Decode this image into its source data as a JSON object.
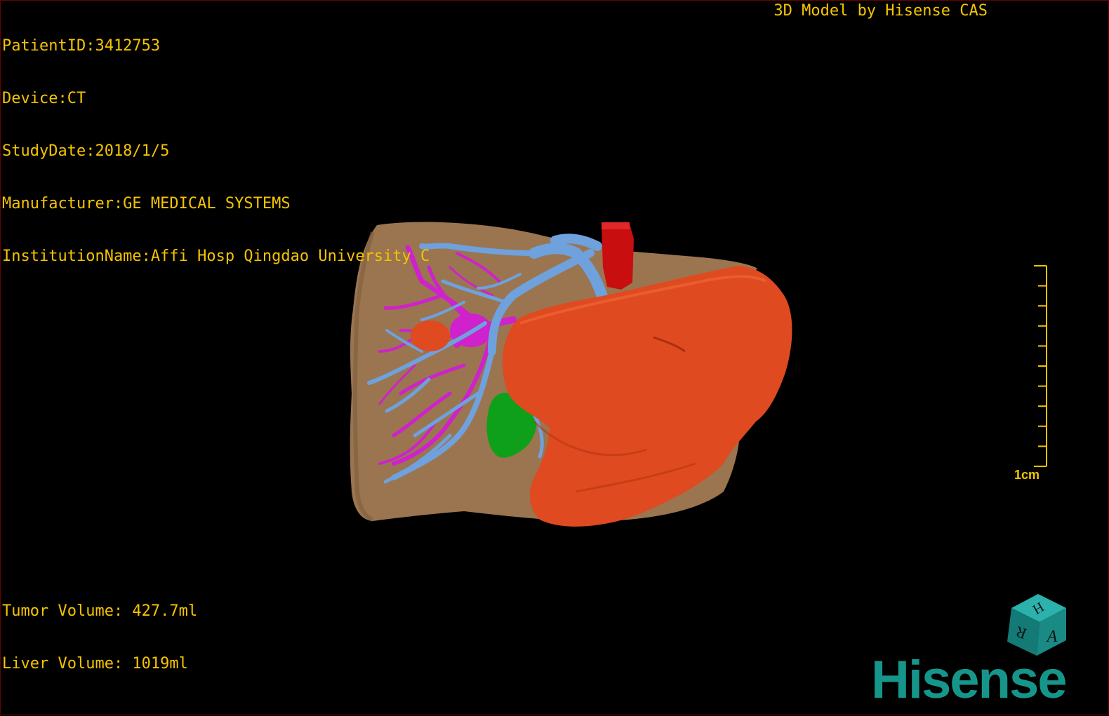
{
  "header": {
    "lines": [
      "PatientID:3412753",
      "Device:CT",
      "StudyDate:2018/1/5",
      "Manufacturer:GE MEDICAL SYSTEMS",
      "InstitutionName:Affi Hosp Qingdao University C"
    ],
    "credit": "3D Model by Hisense CAS"
  },
  "footer": {
    "tumor_volume": "Tumor Volume: 427.7ml",
    "liver_volume": "Liver Volume: 1019ml"
  },
  "scale": {
    "label": "1cm",
    "ticks": 10
  },
  "orientation_cube": {
    "letters": [
      "H",
      "R",
      "A"
    ],
    "color": "#1a8a85"
  },
  "brand": {
    "name": "Hisense",
    "color": "#16968a"
  },
  "model": {
    "colors": {
      "liver": "#9a7550",
      "tumor": "#df4a20",
      "portal_vein": "#6fa1dd",
      "hepatic_artery": "#cf21cc",
      "aorta": "#c80e0e",
      "gallbladder": "#0ea01a"
    },
    "structures": [
      "liver",
      "tumor",
      "portal-vein",
      "hepatic-artery",
      "aorta",
      "gallbladder",
      "small-tumor"
    ]
  }
}
